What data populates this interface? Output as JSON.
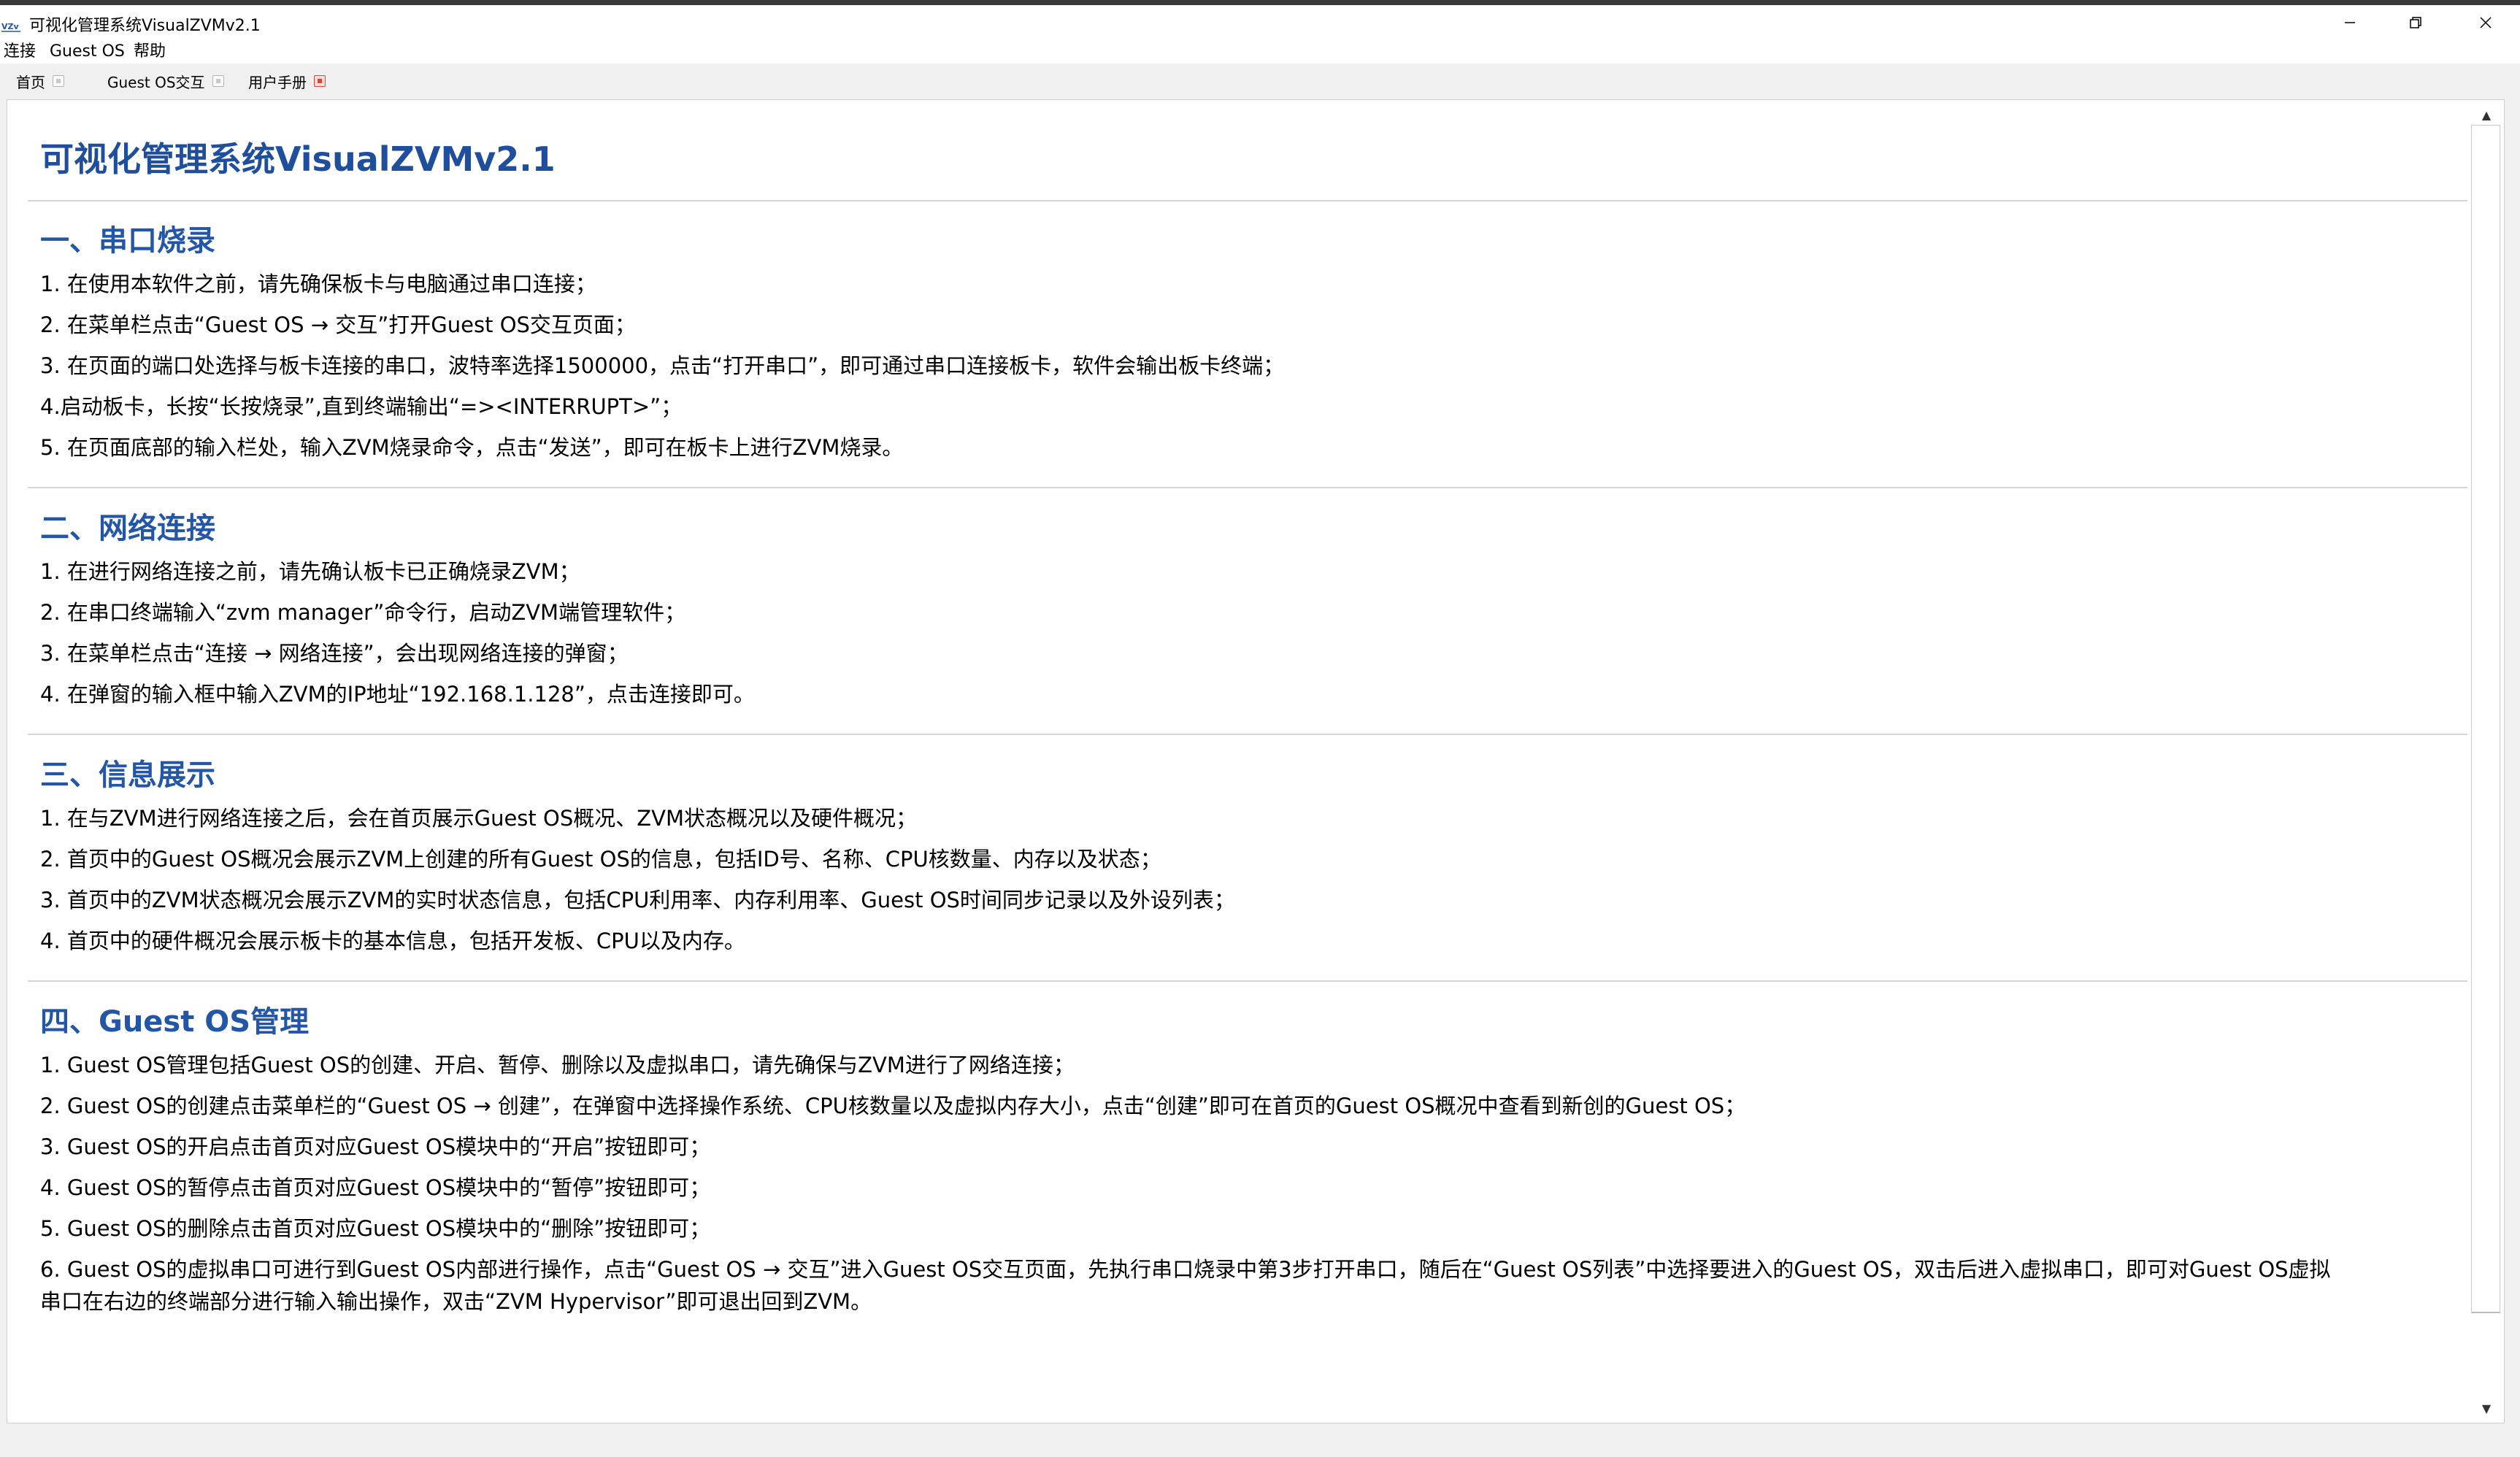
{
  "window": {
    "title": "可视化管理系统VisualZVMv2.1",
    "logo_text": "VZv",
    "controls": {
      "minimize": "─",
      "maximize": "❐",
      "close": "✕"
    }
  },
  "menu": {
    "connect": "连接",
    "guest_os": "Guest OS",
    "help": "帮助"
  },
  "tabs": [
    {
      "label": "首页",
      "active": false
    },
    {
      "label": "Guest OS交互",
      "active": false
    },
    {
      "label": "用户手册",
      "active": true
    }
  ],
  "doc": {
    "title": "可视化管理系统VisualZVMv2.1",
    "sections": [
      {
        "heading": "一、串口烧录",
        "items": [
          "1. 在使用本软件之前，请先确保板卡与电脑通过串口连接；",
          "2. 在菜单栏点击“Guest OS → 交互”打开Guest OS交互页面；",
          "3. 在页面的端口处选择与板卡连接的串口，波特率选择1500000，点击“打开串口”，即可通过串口连接板卡，软件会输出板卡终端；",
          "4.启动板卡，长按“长按烧录”,直到终端输出“=><INTERRUPT>”；",
          "5. 在页面底部的输入栏处，输入ZVM烧录命令，点击“发送”，即可在板卡上进行ZVM烧录。"
        ]
      },
      {
        "heading": "二、网络连接",
        "items": [
          "1. 在进行网络连接之前，请先确认板卡已正确烧录ZVM；",
          "2. 在串口终端输入“zvm manager”命令行，启动ZVM端管理软件；",
          "3. 在菜单栏点击“连接 → 网络连接”，会出现网络连接的弹窗；",
          "4. 在弹窗的输入框中输入ZVM的IP地址“192.168.1.128”，点击连接即可。"
        ]
      },
      {
        "heading": "三、信息展示",
        "items": [
          "1. 在与ZVM进行网络连接之后，会在首页展示Guest OS概况、ZVM状态概况以及硬件概况；",
          "2. 首页中的Guest OS概况会展示ZVM上创建的所有Guest OS的信息，包括ID号、名称、CPU核数量、内存以及状态；",
          "3. 首页中的ZVM状态概况会展示ZVM的实时状态信息，包括CPU利用率、内存利用率、Guest OS时间同步记录以及外设列表；",
          "4. 首页中的硬件概况会展示板卡的基本信息，包括开发板、CPU以及内存。"
        ]
      },
      {
        "heading": "四、Guest OS管理",
        "items": [
          "1. Guest OS管理包括Guest OS的创建、开启、暂停、删除以及虚拟串口，请先确保与ZVM进行了网络连接；",
          "2. Guest OS的创建点击菜单栏的“Guest OS → 创建”，在弹窗中选择操作系统、CPU核数量以及虚拟内存大小，点击“创建”即可在首页的Guest OS概况中查看到新创的Guest OS；",
          "3. Guest OS的开启点击首页对应Guest OS模块中的“开启”按钮即可；",
          "4. Guest OS的暂停点击首页对应Guest OS模块中的“暂停”按钮即可；",
          "5. Guest OS的删除点击首页对应Guest OS模块中的“删除”按钮即可；",
          "6. Guest OS的虚拟串口可进行到Guest OS内部进行操作，点击“Guest OS → 交互”进入Guest OS交互页面，先执行串口烧录中第3步打开串口，随后在“Guest OS列表”中选择要进入的Guest OS，双击后进入虚拟串口，即可对Guest OS虚拟",
          "串口在右边的终端部分进行输入输出操作，双击“ZVM Hypervisor”即可退出回到ZVM。"
        ]
      }
    ]
  },
  "scrollbar": {
    "up_arrow": "▲",
    "down_arrow": "▼"
  }
}
